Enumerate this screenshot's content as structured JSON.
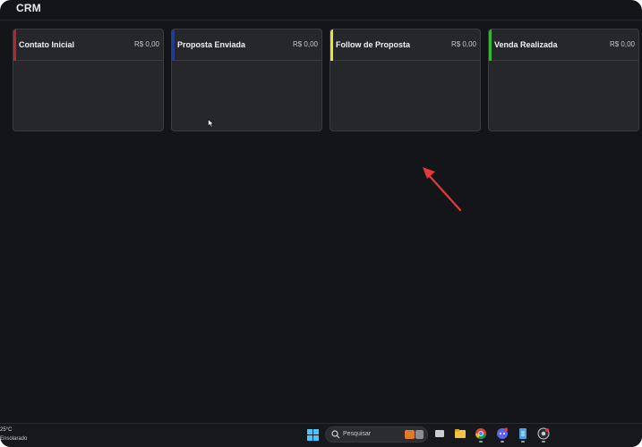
{
  "app": {
    "title": "CRM"
  },
  "columns": [
    {
      "title": "Contato Inicial",
      "total": "R$ 0,00",
      "accent": "#c0202a"
    },
    {
      "title": "Proposta Enviada",
      "total": "R$ 0,00",
      "accent": "#1e3f8f"
    },
    {
      "title": "Follow de Proposta",
      "total": "R$ 0,00",
      "accent": "#e6e62a"
    },
    {
      "title": "Venda Realizada",
      "total": "R$ 0,00",
      "accent": "#35b535"
    }
  ],
  "annotation": {
    "arrow_color": "#e23a3a"
  },
  "taskbar": {
    "weather": {
      "temp": "25°C",
      "desc": "Ensolarado"
    },
    "search": {
      "placeholder": "Pesquisar"
    },
    "icons": [
      "windows-start-icon",
      "task-view-icon",
      "file-explorer-icon",
      "chrome-icon",
      "discord-icon",
      "notepad-icon",
      "chrome-profile-icon"
    ]
  }
}
